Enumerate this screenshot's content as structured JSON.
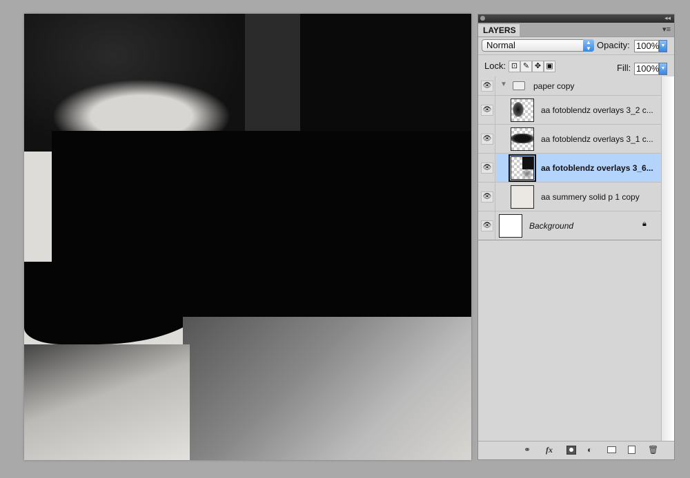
{
  "panel": {
    "tab": "LAYERS",
    "blend_mode": "Normal",
    "opacity_label": "Opacity:",
    "opacity_value": "100%",
    "lock_label": "Lock:",
    "fill_label": "Fill:",
    "fill_value": "100%",
    "layers": [
      {
        "name": "paper copy",
        "type": "group",
        "visible": true
      },
      {
        "name": "aa fotoblendz overlays 3_2 c...",
        "visible": true
      },
      {
        "name": "aa fotoblendz overlays 3_1 c...",
        "visible": true
      },
      {
        "name": "aa fotoblendz overlays 3_6...",
        "visible": true,
        "selected": true
      },
      {
        "name": "aa summery solid p 1 copy",
        "visible": true
      },
      {
        "name": "Background",
        "visible": true,
        "locked": true
      }
    ],
    "bottom_icons": [
      "link-icon",
      "fx-icon",
      "mask-icon",
      "adjustment-icon",
      "folder-icon",
      "new-layer-icon",
      "trash-icon"
    ],
    "selection_color": "#b4d4fc"
  }
}
